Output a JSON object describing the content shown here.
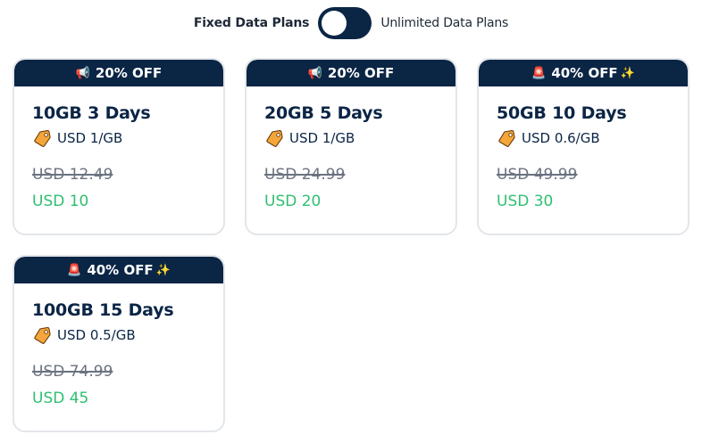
{
  "toggle": {
    "left_label": "Fixed Data Plans",
    "right_label": "Unlimited Data Plans"
  },
  "plans": [
    {
      "badge": "20% OFF",
      "badge_icon_before": "📢",
      "badge_icon_after": "",
      "name": "10GB 3 Days",
      "unit_price": "USD 1/GB",
      "old_price": "USD  12.49",
      "new_price": "USD 10"
    },
    {
      "badge": "20% OFF",
      "badge_icon_before": "📢",
      "badge_icon_after": "",
      "name": "20GB 5 Days",
      "unit_price": "USD 1/GB",
      "old_price": "USD  24.99",
      "new_price": "USD 20"
    },
    {
      "badge": "40% OFF",
      "badge_icon_before": "🚨",
      "badge_icon_after": "✨",
      "name": "50GB 10 Days",
      "unit_price": "USD 0.6/GB",
      "old_price": "USD  49.99",
      "new_price": "USD 30"
    },
    {
      "badge": "40% OFF",
      "badge_icon_before": "🚨",
      "badge_icon_after": "✨",
      "name": "100GB 15 Days",
      "unit_price": "USD 0.5/GB",
      "old_price": "USD  74.99",
      "new_price": "USD 45"
    }
  ],
  "colors": {
    "navy": "#0b2545",
    "green": "#2fbf71",
    "strike_gray": "#6b7280",
    "tag_orange": "#f4a63a"
  }
}
